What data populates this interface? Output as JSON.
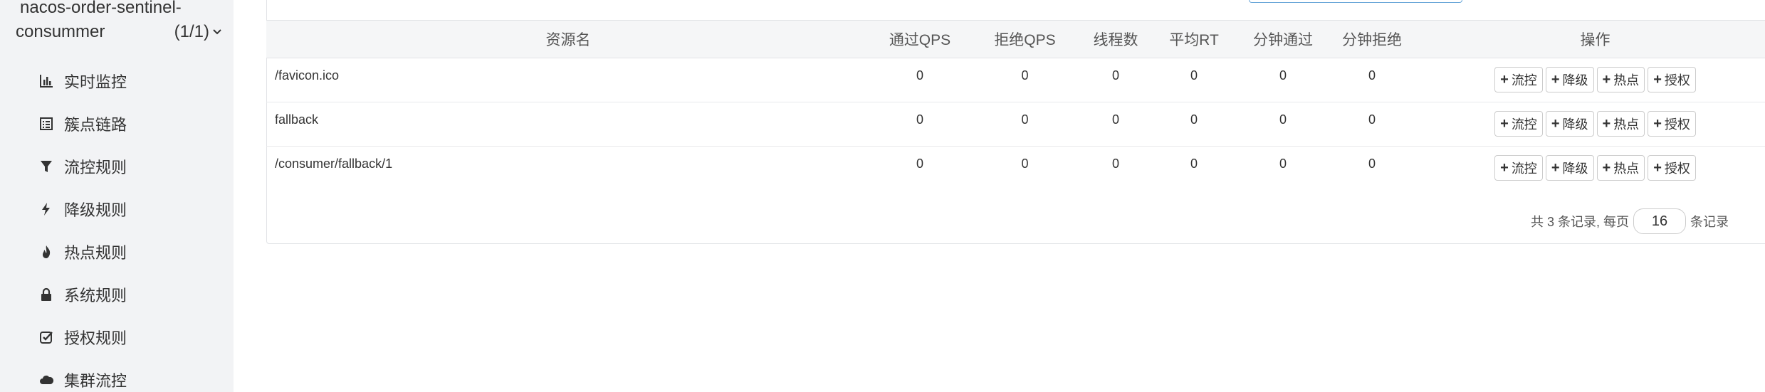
{
  "sidebar": {
    "app_name_line1": "nacos-order-sentinel-",
    "app_name_line2": "consummer",
    "app_count": "(1/1)",
    "items": [
      {
        "label": "实时监控",
        "icon": "bar-chart-icon"
      },
      {
        "label": "簇点链路",
        "icon": "list-icon"
      },
      {
        "label": "流控规则",
        "icon": "filter-icon"
      },
      {
        "label": "降级规则",
        "icon": "flash-icon"
      },
      {
        "label": "热点规则",
        "icon": "fire-icon"
      },
      {
        "label": "系统规则",
        "icon": "lock-icon"
      },
      {
        "label": "授权规则",
        "icon": "check-square-icon"
      },
      {
        "label": "集群流控",
        "icon": "cloud-icon"
      }
    ]
  },
  "table": {
    "headers": [
      "资源名",
      "通过QPS",
      "拒绝QPS",
      "线程数",
      "平均RT",
      "分钟通过",
      "分钟拒绝",
      "操作"
    ],
    "rows": [
      {
        "name": "/favicon.ico",
        "pass_qps": "0",
        "block_qps": "0",
        "threads": "0",
        "avg_rt": "0",
        "min_pass": "0",
        "min_block": "0"
      },
      {
        "name": "fallback",
        "pass_qps": "0",
        "block_qps": "0",
        "threads": "0",
        "avg_rt": "0",
        "min_pass": "0",
        "min_block": "0"
      },
      {
        "name": "/consumer/fallback/1",
        "pass_qps": "0",
        "block_qps": "0",
        "threads": "0",
        "avg_rt": "0",
        "min_pass": "0",
        "min_block": "0"
      }
    ],
    "actions": [
      "流控",
      "降级",
      "热点",
      "授权"
    ]
  },
  "pager": {
    "prefix": "共 3 条记录, 每页",
    "page_size": "16",
    "suffix": "条记录"
  }
}
